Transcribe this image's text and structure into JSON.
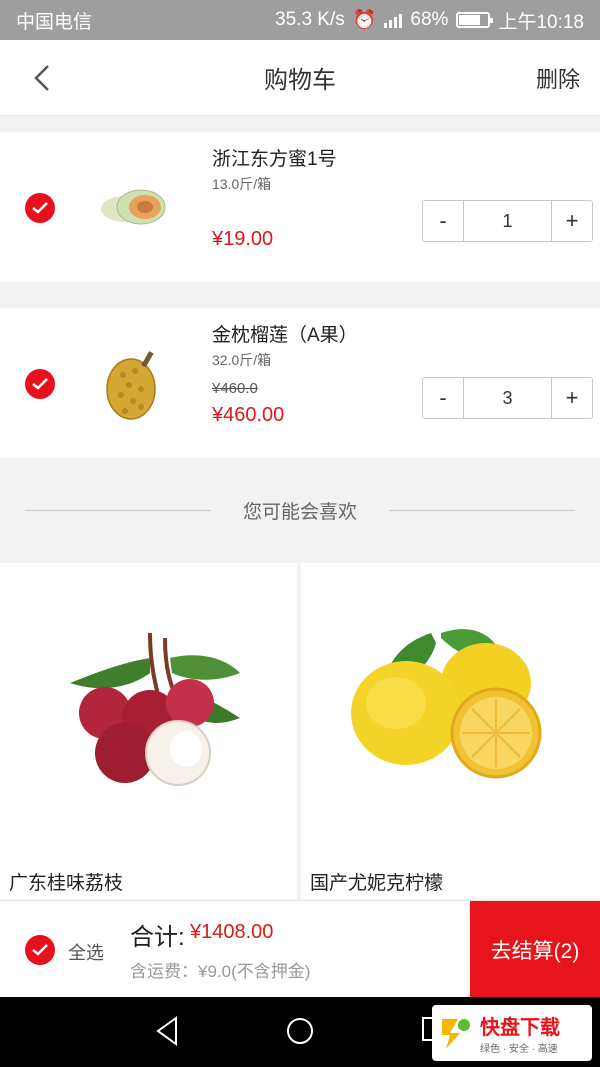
{
  "status_bar": {
    "carrier": "中国电信",
    "speed": "35.3 K/s",
    "network": "4G 2G",
    "battery": "68%",
    "time": "上午10:18"
  },
  "header": {
    "title": "购物车",
    "delete_label": "删除",
    "back_icon": "back-arrow-icon"
  },
  "cart": {
    "items": [
      {
        "name": "浙江东方蜜1号",
        "spec": "13.0斤/箱",
        "original_price": "",
        "price": "¥19.00",
        "quantity": "1",
        "checked": true,
        "image_icon": "melon-icon"
      },
      {
        "name": "金枕榴莲（A果）",
        "spec": "32.0斤/箱",
        "original_price": "¥460.0",
        "price": "¥460.00",
        "quantity": "3",
        "checked": true,
        "image_icon": "durian-icon"
      }
    ],
    "minus_label": "-",
    "plus_label": "+"
  },
  "recommend": {
    "heading": "您可能会喜欢",
    "products": [
      {
        "name": "广东桂味荔枝",
        "image_icon": "lychee-icon"
      },
      {
        "name": "国产尤妮克柠檬",
        "image_icon": "lemon-icon"
      }
    ]
  },
  "footer": {
    "select_all_label": "全选",
    "total_label": "合计:",
    "total_value": "¥1408.00",
    "shipping_note": "含运费：¥9.0(不含押金)",
    "checkout_label": "去结算(2)"
  },
  "watermark": {
    "brand": "快盘下载",
    "slogan": "绿色 · 安全 · 高速"
  },
  "colors": {
    "accent": "#e8141c",
    "price": "#d81a1a",
    "statusbar": "#9e9e9e"
  }
}
